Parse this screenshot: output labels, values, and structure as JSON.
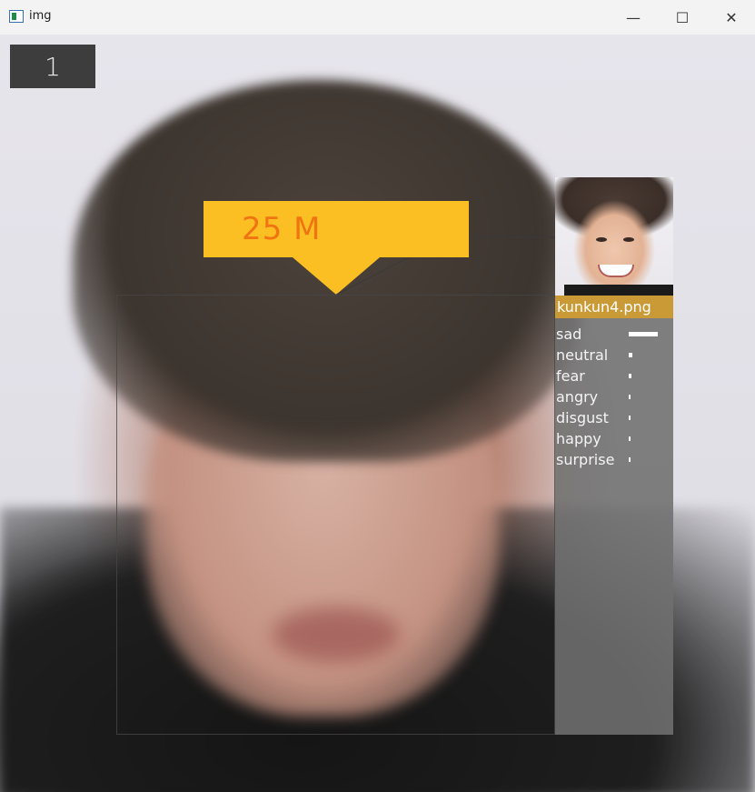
{
  "window": {
    "title": "img",
    "minimize_glyph": "—",
    "maximize_glyph": "☐",
    "close_glyph": "✕"
  },
  "overlay": {
    "frame_counter": "1",
    "age_gender_label": "25  M",
    "match_filename": "kunkun4.png",
    "banner_color": "#fbbf24",
    "banner_text_color": "#f07412",
    "filename_bg_color": "#c99a35"
  },
  "emotions": [
    {
      "label": "sad",
      "score": 1.0
    },
    {
      "label": "neutral",
      "score": 0.12
    },
    {
      "label": "fear",
      "score": 0.1
    },
    {
      "label": "angry",
      "score": 0.07
    },
    {
      "label": "disgust",
      "score": 0.05
    },
    {
      "label": "happy",
      "score": 0.04
    },
    {
      "label": "surprise",
      "score": 0.03
    }
  ],
  "icons": {
    "app": "opencv-window-icon",
    "minimize": "minimize-icon",
    "maximize": "maximize-icon",
    "close": "close-icon"
  }
}
